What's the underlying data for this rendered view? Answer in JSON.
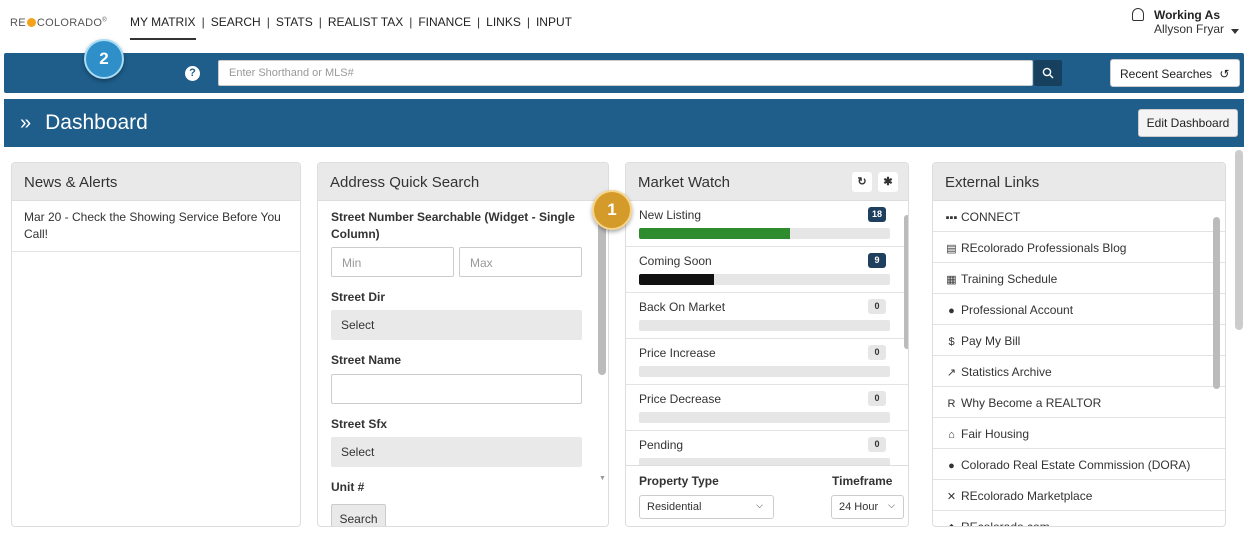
{
  "brand": {
    "logo_left": "RE",
    "logo_right": "COLORADO",
    "reg_mark": "®"
  },
  "nav": {
    "items": [
      "MY MATRIX",
      "SEARCH",
      "STATS",
      "REALIST TAX",
      "FINANCE",
      "LINKS",
      "INPUT"
    ],
    "separator": "|"
  },
  "user": {
    "working_as_label": "Working As",
    "name": "Allyson Fryar"
  },
  "search": {
    "placeholder": "Enter Shorthand or MLS#",
    "recent_label": "Recent Searches"
  },
  "dashboard": {
    "title": "Dashboard",
    "arrow": "»",
    "edit_label": "Edit Dashboard"
  },
  "news": {
    "title": "News & Alerts",
    "items": [
      "Mar 20 - Check the Showing Service Before You Call!"
    ]
  },
  "aqs": {
    "title": "Address Quick Search",
    "street_number_label": "Street Number Searchable (Widget - Single Column)",
    "min_placeholder": "Min",
    "max_placeholder": "Max",
    "street_dir_label": "Street Dir",
    "street_dir_value": "Select",
    "street_name_label": "Street Name",
    "street_sfx_label": "Street Sfx",
    "street_sfx_value": "Select",
    "unit_label": "Unit #",
    "search_label": "Search"
  },
  "market_watch": {
    "title": "Market Watch",
    "rows": [
      {
        "label": "New Listing",
        "count": "18",
        "fill_fraction": 0.6,
        "color": "#2e8b2e",
        "badge_style": "dk"
      },
      {
        "label": "Coming Soon",
        "count": "9",
        "fill_fraction": 0.3,
        "color": "#111111",
        "badge_style": "dk"
      },
      {
        "label": "Back On Market",
        "count": "0",
        "fill_fraction": 0,
        "color": "#e6e6e6",
        "badge_style": "lt"
      },
      {
        "label": "Price Increase",
        "count": "0",
        "fill_fraction": 0,
        "color": "#e6e6e6",
        "badge_style": "lt"
      },
      {
        "label": "Price Decrease",
        "count": "0",
        "fill_fraction": 0,
        "color": "#e6e6e6",
        "badge_style": "lt"
      },
      {
        "label": "Pending",
        "count": "0",
        "fill_fraction": 0,
        "color": "#e6e6e6",
        "badge_style": "lt"
      }
    ],
    "property_type_label": "Property Type",
    "property_type_value": "Residential",
    "timeframe_label": "Timeframe",
    "timeframe_value": "24 Hour"
  },
  "external_links": {
    "title": "External Links",
    "items": [
      {
        "label": "CONNECT",
        "icon": "grid-icon",
        "glyph": "▪▪▪"
      },
      {
        "label": "REcolorado Professionals Blog",
        "icon": "newspaper-icon",
        "glyph": "▤"
      },
      {
        "label": "Training Schedule",
        "icon": "calendar-icon",
        "glyph": "▦"
      },
      {
        "label": "Professional Account",
        "icon": "user-icon",
        "glyph": "●"
      },
      {
        "label": "Pay My Bill",
        "icon": "dollar-icon",
        "glyph": "$"
      },
      {
        "label": "Statistics Archive",
        "icon": "chart-icon",
        "glyph": "↗"
      },
      {
        "label": "Why Become a REALTOR",
        "icon": "realtor-icon",
        "glyph": "R"
      },
      {
        "label": "Fair Housing",
        "icon": "house-icon",
        "glyph": "⌂"
      },
      {
        "label": "Colorado Real Estate Commission (DORA)",
        "icon": "dora-icon",
        "glyph": "●"
      },
      {
        "label": "REcolorado Marketplace",
        "icon": "tools-icon",
        "glyph": "✕"
      },
      {
        "label": "REcolorado.com",
        "icon": "sun-icon",
        "glyph": "◆"
      }
    ]
  },
  "steps": {
    "one": "1",
    "two": "2"
  }
}
